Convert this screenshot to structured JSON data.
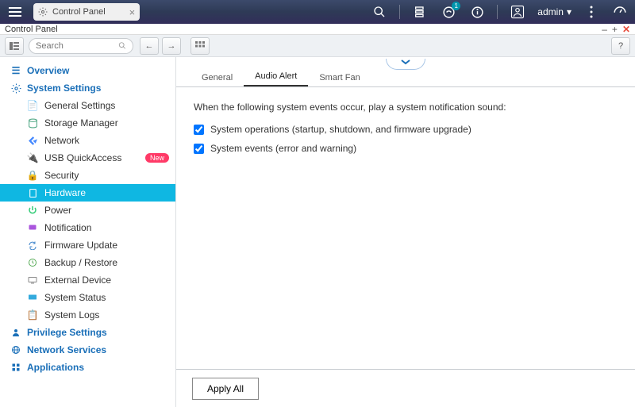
{
  "topbar": {
    "tab_label": "Control Panel",
    "badge": "1",
    "user": "admin"
  },
  "window": {
    "title": "Control Panel"
  },
  "toolbar": {
    "search_placeholder": "Search"
  },
  "sidebar": {
    "overview": "Overview",
    "system_settings": "System Settings",
    "items": [
      {
        "label": "General Settings"
      },
      {
        "label": "Storage Manager"
      },
      {
        "label": "Network"
      },
      {
        "label": "USB QuickAccess",
        "new": "New"
      },
      {
        "label": "Security"
      },
      {
        "label": "Hardware"
      },
      {
        "label": "Power"
      },
      {
        "label": "Notification"
      },
      {
        "label": "Firmware Update"
      },
      {
        "label": "Backup / Restore"
      },
      {
        "label": "External Device"
      },
      {
        "label": "System Status"
      },
      {
        "label": "System Logs"
      }
    ],
    "privilege": "Privilege Settings",
    "network": "Network Services",
    "apps": "Applications"
  },
  "tabs": {
    "general": "General",
    "audio": "Audio Alert",
    "fan": "Smart Fan"
  },
  "content": {
    "description": "When the following system events occur, play a system notification sound:",
    "opt1": "System operations (startup, shutdown, and firmware upgrade)",
    "opt2": "System events (error and warning)"
  },
  "footer": {
    "apply": "Apply All"
  }
}
